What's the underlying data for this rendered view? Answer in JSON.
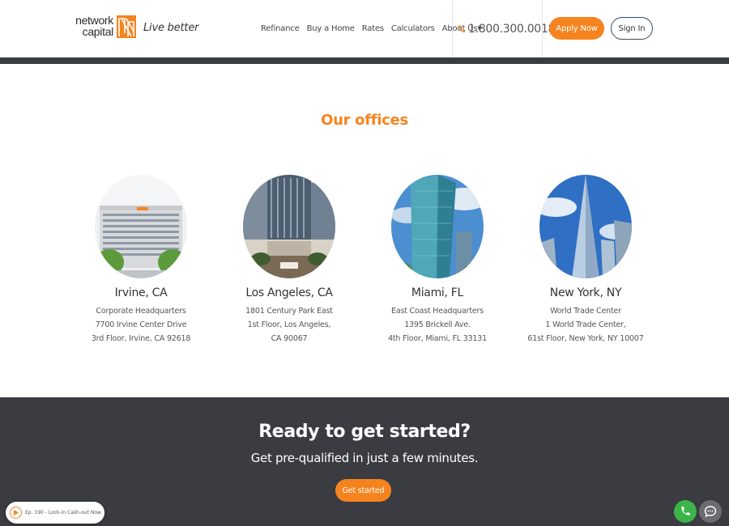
{
  "header": {
    "logo": {
      "line1": "network",
      "line2": "capital",
      "icon": "network-capital-logo-icon"
    },
    "tagline": "Live better",
    "nav": [
      {
        "label": "Refinance"
      },
      {
        "label": "Buy a Home"
      },
      {
        "label": "Rates"
      },
      {
        "label": "Calculators"
      },
      {
        "label": "About Us",
        "has_dropdown": true
      }
    ],
    "phone": {
      "number": "1.800.300.0018",
      "icon": "phone-icon"
    },
    "apply_label": "Apply Now",
    "signin_label": "Sign In"
  },
  "offices": {
    "title": "Our offices",
    "items": [
      {
        "city": "Irvine, CA",
        "lines": [
          "Corporate Headquarters",
          "7700 Irvine Center Drive",
          "3rd Floor, Irvine, CA 92618"
        ]
      },
      {
        "city": "Los Angeles, CA",
        "lines": [
          "1801 Century Park East",
          "1st Floor, Los Angeles,",
          "CA 90067"
        ]
      },
      {
        "city": "Miami, FL",
        "lines": [
          "East Coast Headquarters",
          "1395 Brickell Ave.",
          "4th Floor, Miami, FL 33131"
        ]
      },
      {
        "city": "New York, NY",
        "lines": [
          "World Trade Center",
          "1 World Trade Center,",
          "61st Floor, New York, NY 10007"
        ]
      }
    ]
  },
  "cta": {
    "title": "Ready to get started?",
    "subtitle": "Get pre-qualified in just a few minutes.",
    "button_label": "Get started"
  },
  "podcast": {
    "label": "Ep. 190 - Lock-in Cash-out Now",
    "icon": "play-icon"
  },
  "fab": {
    "phone_icon": "phone-icon",
    "chat_icon": "chat-icon"
  },
  "colors": {
    "accent": "#f5841f",
    "dark": "#3a3c41",
    "call_green": "#3bb54a"
  }
}
